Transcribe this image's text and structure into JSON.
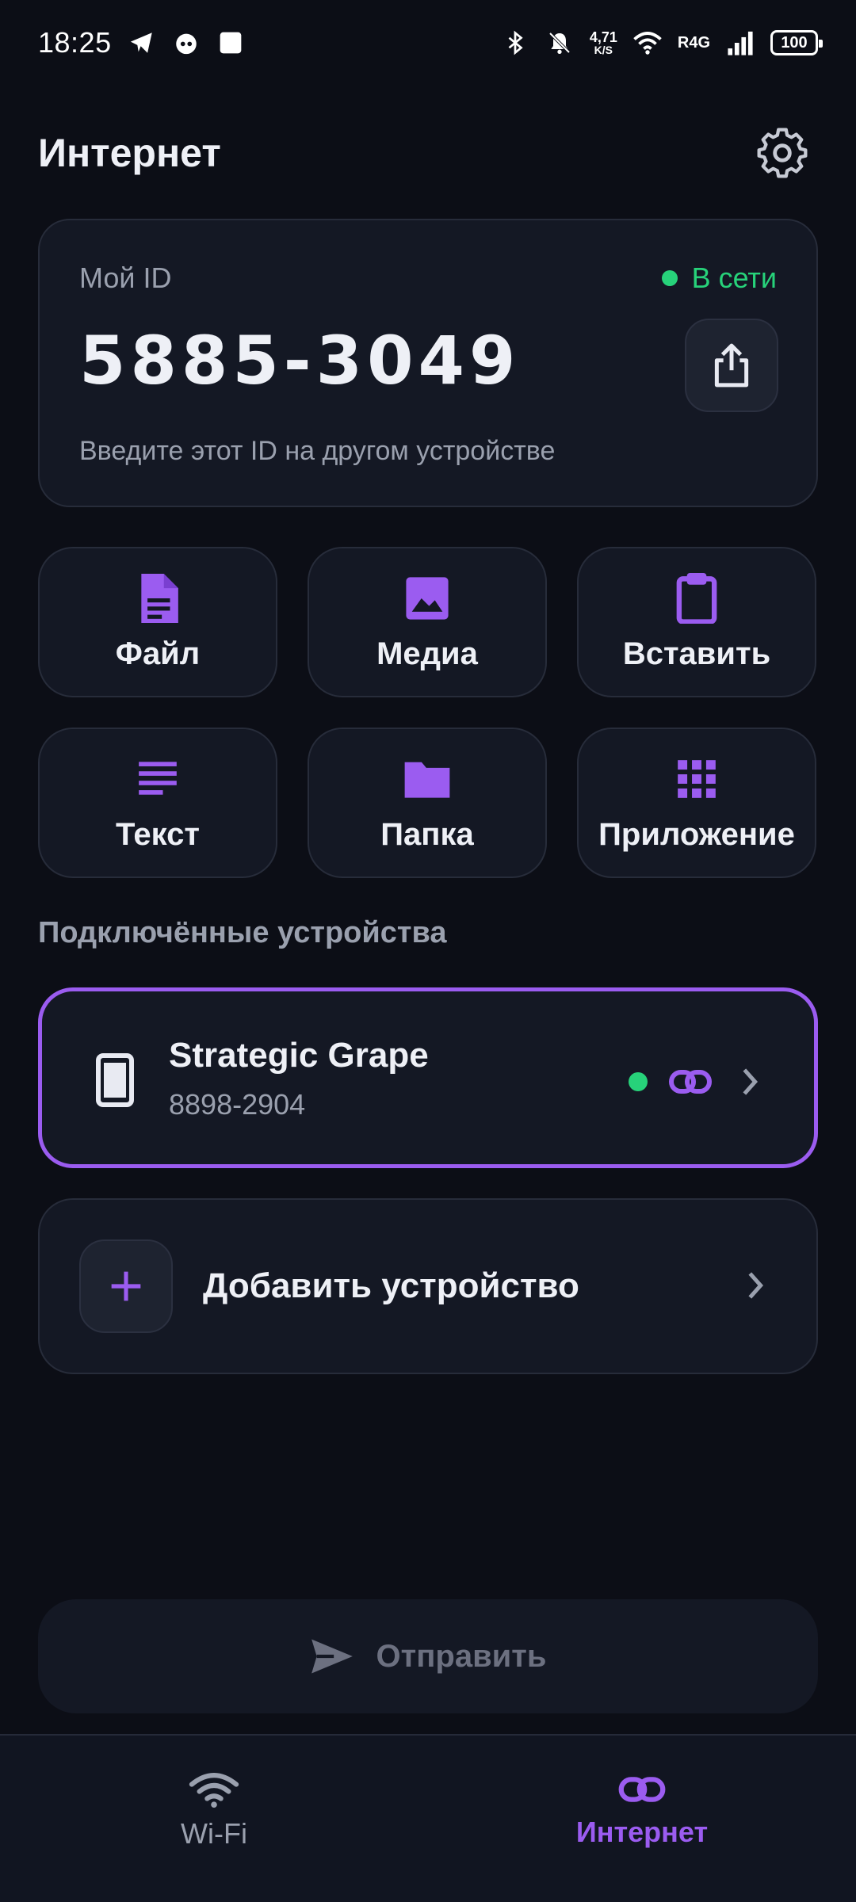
{
  "status_bar": {
    "time": "18:25",
    "net_speed_value": "4,71",
    "net_speed_unit": "K/S",
    "network_type": "R4G",
    "battery": "100"
  },
  "header": {
    "title": "Интернет"
  },
  "id_card": {
    "label": "Мой ID",
    "status": "В сети",
    "id_value": "5885-3049",
    "hint": "Введите этот ID на другом устройстве"
  },
  "actions": [
    {
      "label": "Файл",
      "icon": "file-icon"
    },
    {
      "label": "Медиа",
      "icon": "image-icon"
    },
    {
      "label": "Вставить",
      "icon": "clipboard-icon"
    },
    {
      "label": "Текст",
      "icon": "text-lines-icon"
    },
    {
      "label": "Папка",
      "icon": "folder-icon"
    },
    {
      "label": "Приложение",
      "icon": "apps-grid-icon"
    }
  ],
  "connected": {
    "section_title": "Подключённые устройства",
    "device": {
      "name": "Strategic Grape",
      "id": "8898-2904"
    }
  },
  "add_device": {
    "label": "Добавить устройство"
  },
  "send": {
    "label": "Отправить"
  },
  "bottom_nav": {
    "wifi_label": "Wi-Fi",
    "internet_label": "Интернет"
  },
  "colors": {
    "accent": "#9b5cf0",
    "online": "#27d27a",
    "background": "#0c0e16",
    "card": "#141824"
  }
}
